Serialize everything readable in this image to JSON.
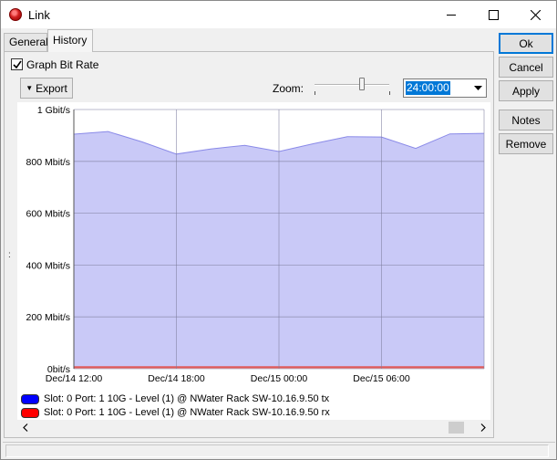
{
  "window": {
    "title": "Link",
    "minimize_icon": "minimize-icon",
    "maximize_icon": "maximize-icon",
    "close_icon": "close-icon"
  },
  "tabs": [
    {
      "label": "General",
      "active": false
    },
    {
      "label": "History",
      "active": true
    }
  ],
  "graph_bit_rate": {
    "label": "Graph Bit Rate",
    "checked": true
  },
  "export_button": {
    "label": "Export"
  },
  "zoom": {
    "label": "Zoom:",
    "slider_level": 0.64,
    "selected": "24:00:00"
  },
  "side_buttons": {
    "ok": "Ok",
    "cancel": "Cancel",
    "apply": "Apply",
    "notes": "Notes",
    "remove": "Remove"
  },
  "chart_data": {
    "type": "area",
    "y_ticks": [
      "1 Gbit/s",
      "800 Mbit/s",
      "600 Mbit/s",
      "400 Mbit/s",
      "200 Mbit/s",
      "0bit/s"
    ],
    "x_ticks": [
      "Dec/14 12:00",
      "Dec/14 18:00",
      "Dec/15 00:00",
      "Dec/15 06:00"
    ],
    "ylim_mbps": [
      0,
      1000
    ],
    "x_hours_from_first_tick": [
      0,
      2,
      4,
      6,
      8,
      10,
      12,
      14,
      16,
      18,
      20,
      22,
      24
    ],
    "series": [
      {
        "name": "Slot: 0 Port: 1 10G - Level (1) @ NWater Rack SW-10.16.9.50 tx",
        "color": "#0000ff",
        "fill": "#c9c9f7",
        "stroke": "#8a8ae8",
        "values_mbps": [
          905,
          915,
          875,
          828,
          848,
          862,
          838,
          868,
          895,
          894,
          850,
          906,
          908
        ]
      },
      {
        "name": "Slot: 0 Port: 1 10G - Level (1) @ NWater Rack SW-10.16.9.50 rx",
        "color": "#ff0000",
        "fill": "#f4a0a0",
        "stroke": "#e05a5a",
        "values_mbps": [
          6,
          6,
          6,
          6,
          6,
          6,
          6,
          6,
          6,
          6,
          6,
          6,
          6
        ]
      }
    ],
    "grid": true,
    "legend_position": "bottom-left"
  },
  "colors": {
    "accent": "#0078d7",
    "grid": "#7f7f9f"
  }
}
